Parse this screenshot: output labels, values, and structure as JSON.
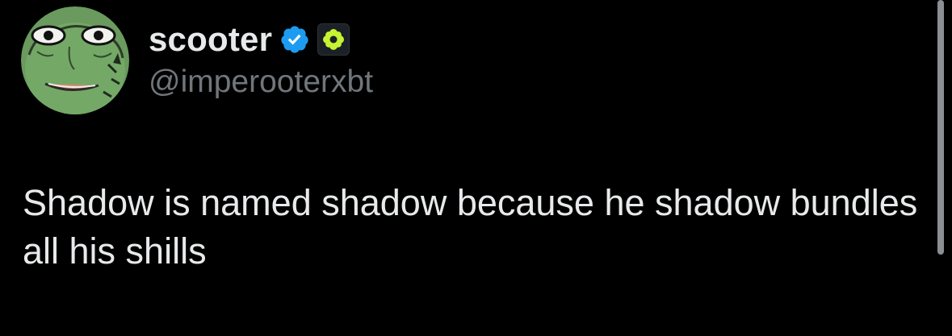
{
  "author": {
    "display_name": "scooter",
    "handle": "@imperooterxbt",
    "verified_icon": "verified-check-icon",
    "affiliate_icon": "flower-badge-icon",
    "avatar_icon": "green-face-avatar"
  },
  "post": {
    "text": "Shadow is named shadow because he shadow bundles all his shills"
  },
  "colors": {
    "background": "#000000",
    "text_primary": "#e7e9ea",
    "text_secondary": "#71767b",
    "verified_blue": "#1d9bf0",
    "badge_green": "#c6f432"
  }
}
